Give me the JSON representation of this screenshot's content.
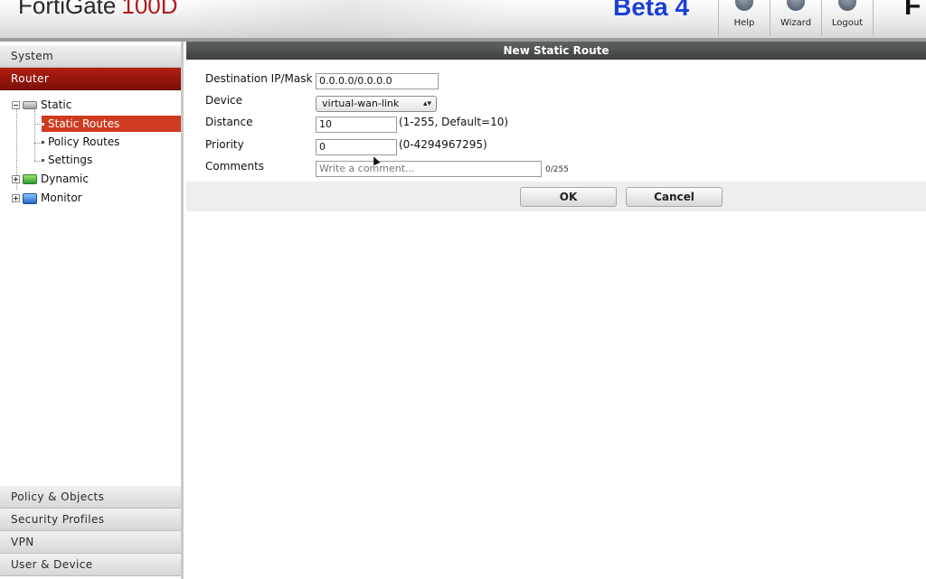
{
  "header": {
    "product_name": "FortiGate",
    "model": "100D",
    "release_tag": "Beta 4",
    "buttons": [
      {
        "label": "Help",
        "icon": "help-icon"
      },
      {
        "label": "Wizard",
        "icon": "wizard-icon"
      },
      {
        "label": "Logout",
        "icon": "logout-icon"
      }
    ],
    "brand_mark": "F"
  },
  "sidebar": {
    "top_sections": [
      {
        "label": "System"
      },
      {
        "label": "Router",
        "active": true
      }
    ],
    "tree": {
      "static": {
        "label": "Static",
        "icon": "static-route-icon"
      },
      "static_routes": {
        "label": "Static Routes",
        "selected": true
      },
      "policy_routes": {
        "label": "Policy Routes"
      },
      "settings": {
        "label": "Settings"
      },
      "dynamic": {
        "label": "Dynamic",
        "icon": "dynamic-route-icon"
      },
      "monitor": {
        "label": "Monitor",
        "icon": "monitor-icon"
      }
    },
    "bottom_sections": [
      {
        "label": "Policy & Objects"
      },
      {
        "label": "Security Profiles"
      },
      {
        "label": "VPN"
      },
      {
        "label": "User & Device"
      }
    ]
  },
  "panel": {
    "title": "New Static Route",
    "fields": {
      "destination": {
        "label": "Destination IP/Mask",
        "value": "0.0.0.0/0.0.0.0"
      },
      "device": {
        "label": "Device",
        "value": "virtual-wan-link"
      },
      "distance": {
        "label": "Distance",
        "value": "10",
        "hint": "(1-255, Default=10)"
      },
      "priority": {
        "label": "Priority",
        "value": "0",
        "hint": "(0-4294967295)"
      },
      "comments": {
        "label": "Comments",
        "placeholder": "Write a comment...",
        "counter": "0/255"
      }
    },
    "ok_label": "OK",
    "cancel_label": "Cancel"
  }
}
